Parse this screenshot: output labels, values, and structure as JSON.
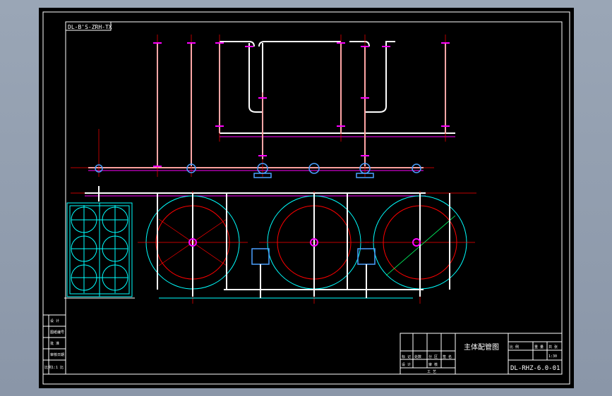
{
  "drawing": {
    "stamp_code": "DL-B'S-ZRH-TX",
    "title": "主体配管图",
    "drawing_number": "DL-RHZ-6.0-01",
    "revision_block": {
      "rows": [
        "设 计",
        "图纸编号",
        "批 准",
        "审核日期",
        "比例1:1 比"
      ]
    },
    "title_block_labels": {
      "l1": "标 记",
      "l2": "处数",
      "l3": "分 区",
      "l4": "签 名",
      "l5": "设 计",
      "l6": "审 核",
      "l7": "工 艺",
      "scale_label": "比 例",
      "scale_value": "1:30",
      "weight_label": "重 量",
      "sheet_label": "共 张"
    }
  },
  "colors": {
    "background": "#000000",
    "frame": "#ffffff",
    "pipe": "#ffffff",
    "centerline": "#ff0000",
    "tank_outer": "#00ffff",
    "tank_inner": "#ff0000",
    "flange": "#ff00ff",
    "pump": "#4aa0ff"
  }
}
